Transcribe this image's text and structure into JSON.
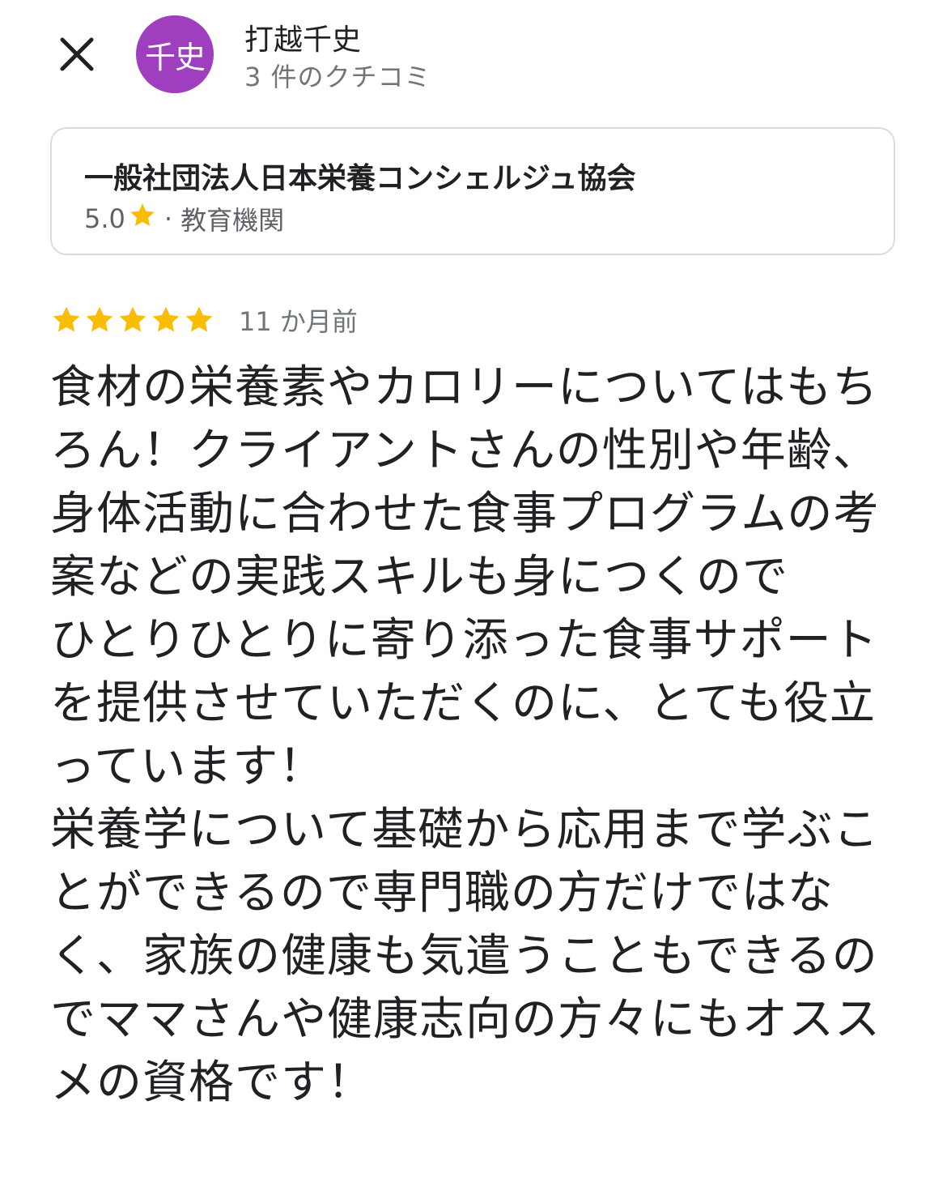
{
  "header": {
    "close_icon": "close-icon",
    "avatar_text": "千史",
    "avatar_color": "#9f3fbf",
    "reviewer_name": "打越千史",
    "review_count": "3 件のクチコミ"
  },
  "place": {
    "name": "一般社団法人日本栄養コンシェルジュ協会",
    "rating": "5.0",
    "star_icon": "star-icon",
    "separator": "·",
    "category": "教育機関"
  },
  "review": {
    "stars": 5,
    "star_color": "#fbbc04",
    "date": "11 か月前",
    "text": "食材の栄養素やカロリーについてはもちろん！クライアントさんの性別や年齢、身体活動に合わせた食事プログラムの考案などの実践スキルも身につくので\nひとりひとりに寄り添った食事サポートを提供させていただくのに、とても役立っています！\n栄養学について基礎から応用まで学ぶことができるので専門職の方だけではなく、家族の健康も気遣うこともできるのでママさんや健康志向の方々にもオススメの資格です！"
  }
}
